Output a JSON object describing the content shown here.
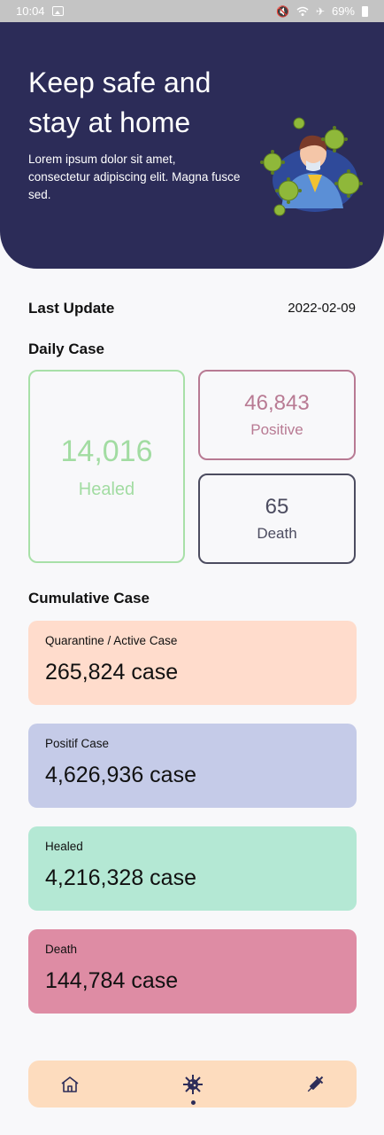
{
  "status_bar": {
    "time": "10:04",
    "battery": "69%"
  },
  "hero": {
    "title": "Keep safe and stay at home",
    "description": "Lorem ipsum dolor sit amet, consectetur adipiscing elit. Magna fusce sed."
  },
  "last_update": {
    "label": "Last Update",
    "date": "2022-02-09"
  },
  "daily": {
    "label": "Daily Case",
    "healed": {
      "value": "14,016",
      "label": "Healed"
    },
    "positive": {
      "value": "46,843",
      "label": "Positive"
    },
    "death": {
      "value": "65",
      "label": "Death"
    }
  },
  "cumulative": {
    "label": "Cumulative Case",
    "cards": [
      {
        "title": "Quarantine / Active Case",
        "value": "265,824 case",
        "color": "#ffdccc"
      },
      {
        "title": "Positif Case",
        "value": "4,626,936 case",
        "color": "#c5cbe8"
      },
      {
        "title": "Healed",
        "value": "4,216,328 case",
        "color": "#b4e8d4"
      },
      {
        "title": "Death",
        "value": "144,784 case",
        "color": "#de8ca4"
      }
    ]
  },
  "nav": {
    "items": [
      "home-icon",
      "virus-icon",
      "syringe-icon"
    ],
    "active_index": 1
  },
  "colors": {
    "hero_bg": "#2c2c58",
    "nav_bg": "#fddcbe"
  }
}
